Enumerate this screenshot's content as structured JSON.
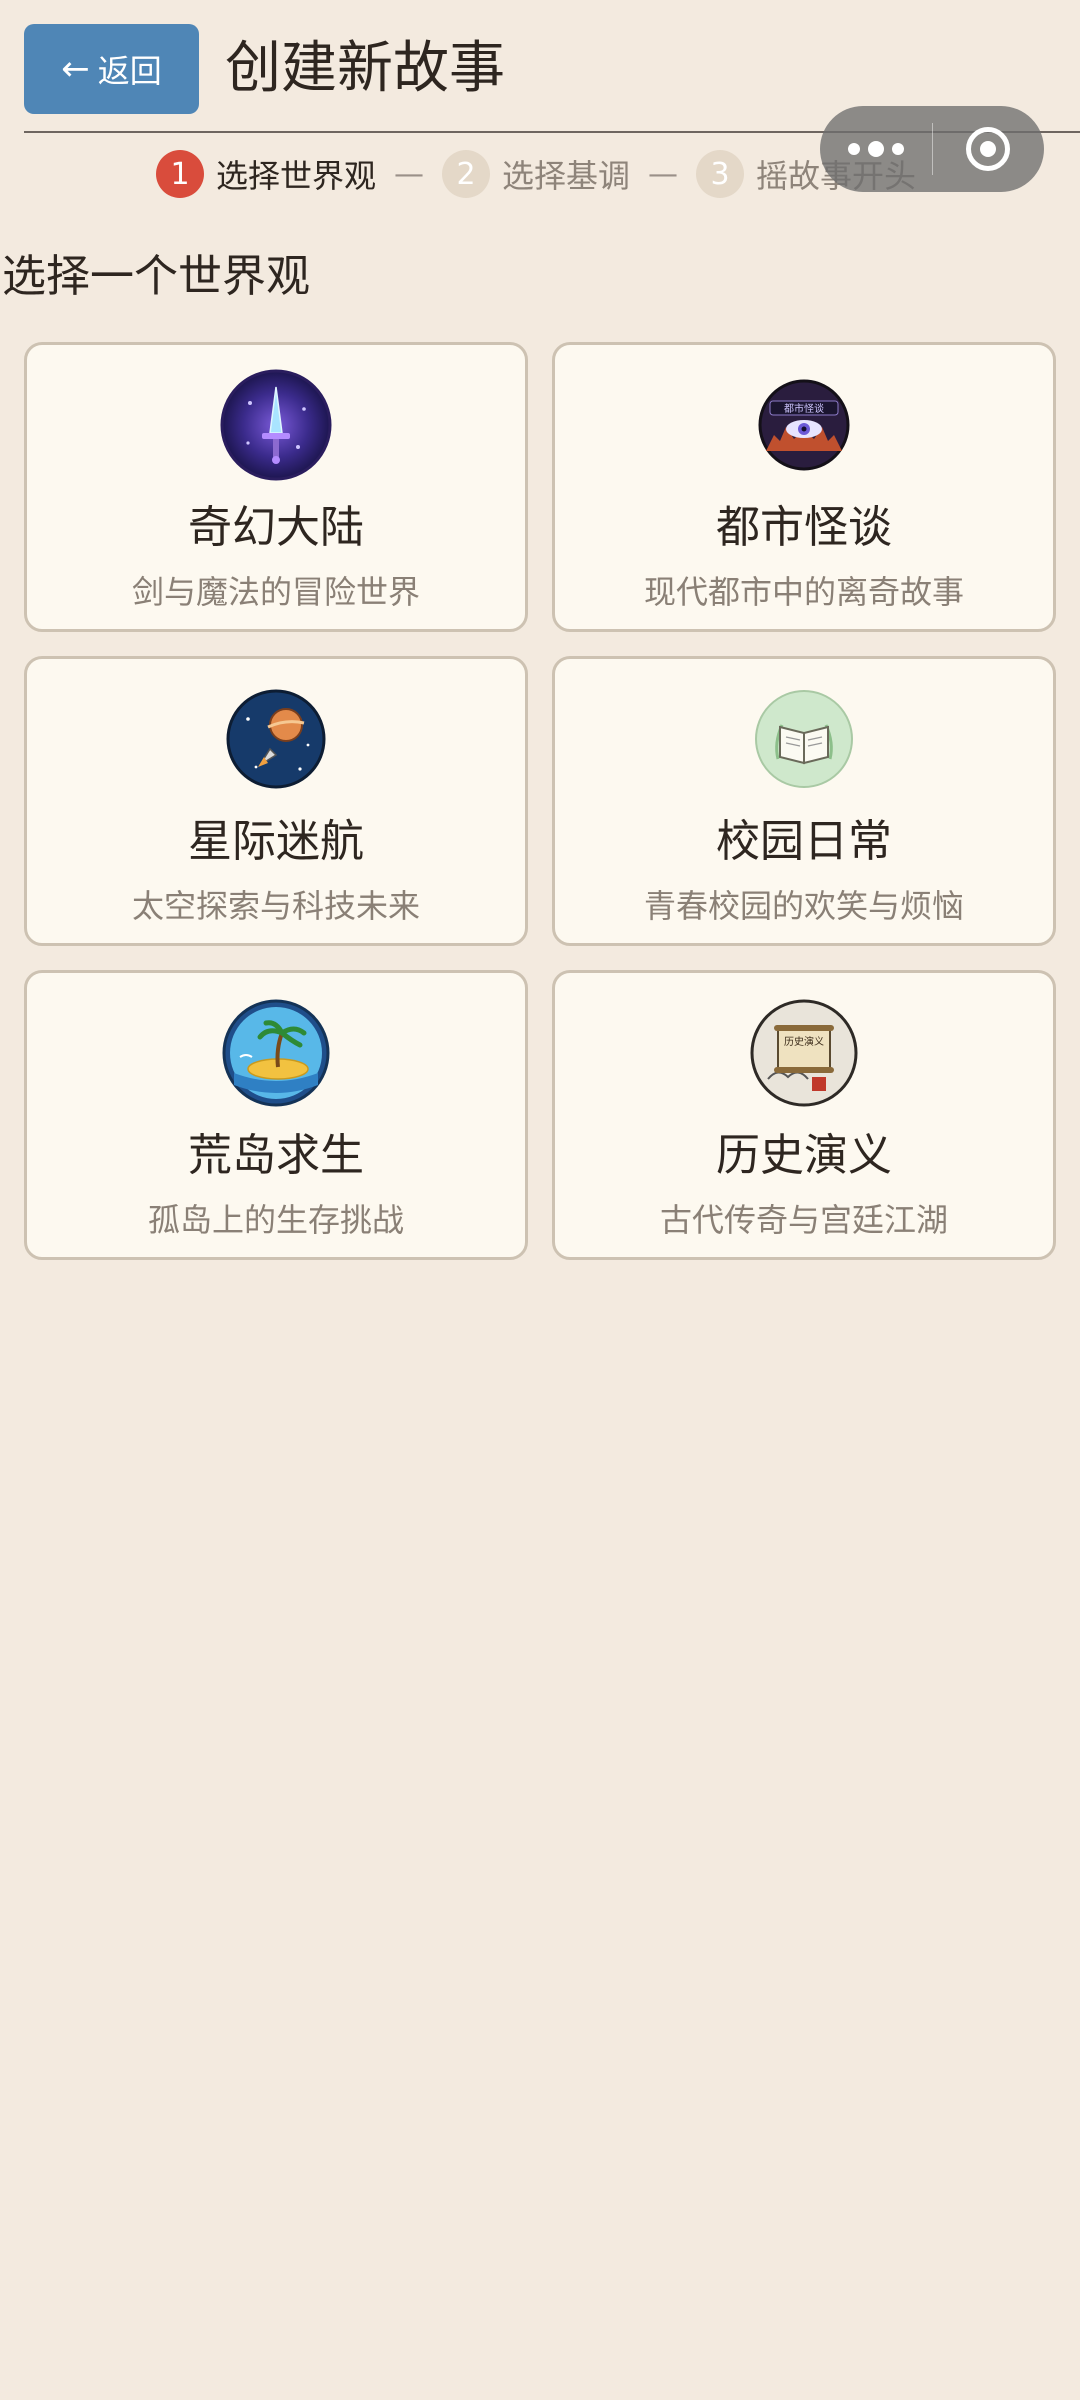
{
  "header": {
    "back_arrow": "←",
    "back_label": "返回",
    "title": "创建新故事"
  },
  "steps": [
    {
      "num": "1",
      "label": "选择世界观",
      "state": "active"
    },
    {
      "num": "2",
      "label": "选择基调",
      "state": "inactive"
    },
    {
      "num": "3",
      "label": "摇故事开头",
      "state": "inactive"
    }
  ],
  "step_separator": "—",
  "section_title": "选择一个世界观",
  "worlds": [
    {
      "name": "奇幻大陆",
      "desc": "剑与魔法的冒险世界",
      "icon": "magic-sword-icon"
    },
    {
      "name": "都市怪谈",
      "desc": "现代都市中的离奇故事",
      "icon": "city-eye-icon"
    },
    {
      "name": "星际迷航",
      "desc": "太空探索与科技未来",
      "icon": "rocket-planet-icon"
    },
    {
      "name": "校园日常",
      "desc": "青春校园的欢笑与烦恼",
      "icon": "open-book-icon"
    },
    {
      "name": "荒岛求生",
      "desc": "孤岛上的生存挑战",
      "icon": "palm-island-icon"
    },
    {
      "name": "历史演义",
      "desc": "古代传奇与宫廷江湖",
      "icon": "ancient-scroll-icon"
    }
  ],
  "icon_text": {
    "city_badge": "都市怪谈",
    "scroll_badge": "历史演义"
  },
  "colors": {
    "background": "#f3eadf",
    "accent_blue": "#4f86b6",
    "active_step": "#d94c3c",
    "card_bg": "#fdf9f0",
    "card_border": "#cdc2b2"
  }
}
